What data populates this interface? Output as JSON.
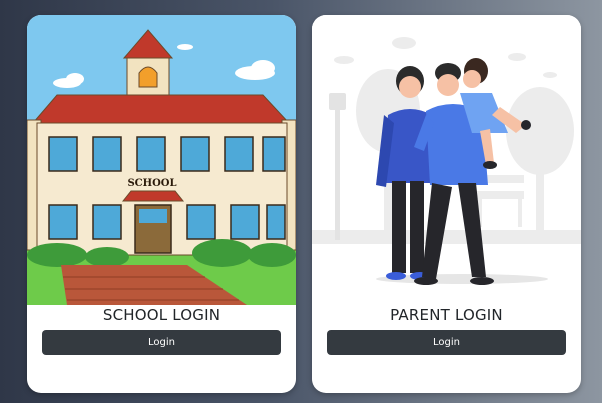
{
  "cards": [
    {
      "title": "SCHOOL LOGIN",
      "button_label": "Login",
      "illustration_sign": "SCHOOL"
    },
    {
      "title": "PARENT LOGIN",
      "button_label": "Login"
    }
  ],
  "colors": {
    "button_bg": "#343a40",
    "button_text": "#ffffff",
    "card_bg": "#ffffff",
    "page_bg_left": "#2f3748",
    "page_bg_right": "#8d96a1"
  }
}
